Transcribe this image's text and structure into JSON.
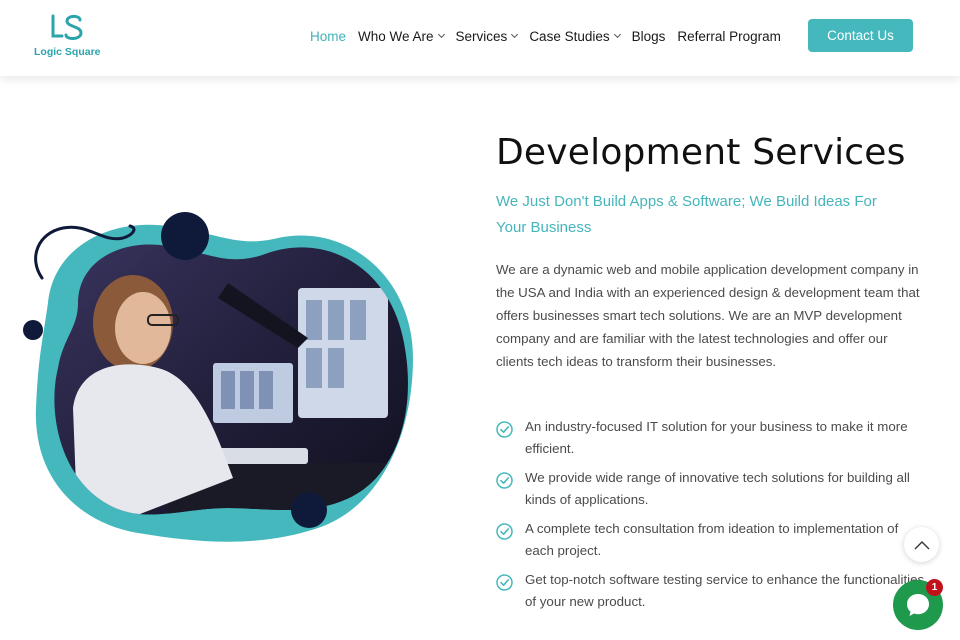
{
  "brand": {
    "logo_text": "Logic Square",
    "color": "#3fb2b8"
  },
  "nav": {
    "items": [
      {
        "label": "Home",
        "active": true,
        "dropdown": false
      },
      {
        "label": "Who We Are",
        "active": false,
        "dropdown": true
      },
      {
        "label": "Services",
        "active": false,
        "dropdown": true
      },
      {
        "label": "Case Studies",
        "active": false,
        "dropdown": true
      },
      {
        "label": "Blogs",
        "active": false,
        "dropdown": false
      },
      {
        "label": "Referral Program",
        "active": false,
        "dropdown": false
      }
    ],
    "contact_label": "Contact Us"
  },
  "main": {
    "title": "Development Services",
    "subtitle": "We Just Don't Build Apps & Software; We Build Ideas For Your Business",
    "paragraph": "We are a dynamic web and mobile application development company in the USA and India with an experienced design & development team that offers businesses smart tech solutions. We are an MVP development company and are familiar with the latest technologies and offer our clients tech ideas to transform their businesses.",
    "features": [
      "An industry-focused IT solution for your business to make it more efficient.",
      "We provide wide range of innovative tech solutions for building all kinds of applications.",
      "A complete tech consultation from ideation to implementation of each project.",
      "Get top-notch software testing service to enhance the functionalities of your new product."
    ]
  },
  "widgets": {
    "chat_badge_count": "1",
    "chat_color": "#1f9a4d",
    "badge_color": "#c0121b"
  },
  "icons": {
    "feature_bullet": "check-circle-icon",
    "scroll": "chevron-up-icon",
    "chat": "chat-bubble-icon"
  }
}
